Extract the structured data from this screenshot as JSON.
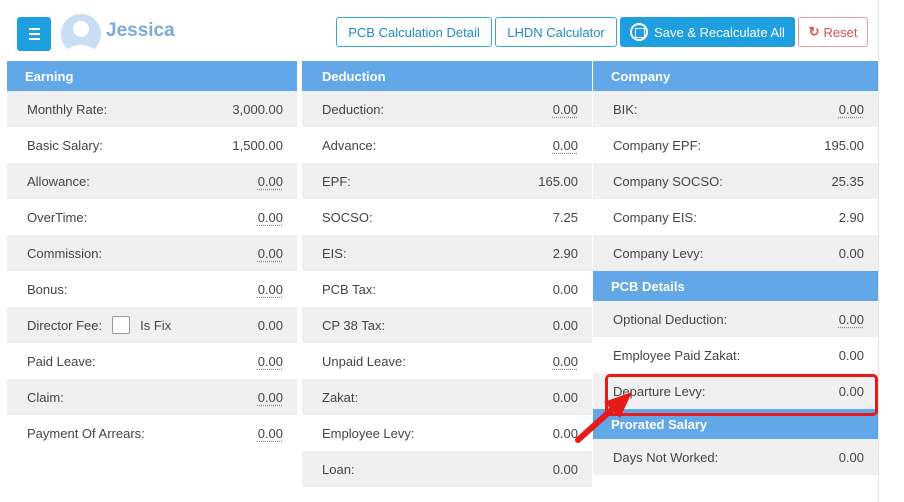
{
  "header": {
    "user_name": "Jessica",
    "buttons": {
      "pcb_detail": "PCB Calculation Detail",
      "lhdn": "LHDN Calculator",
      "save": "Save & Recalculate All",
      "reset": "Reset"
    }
  },
  "earning": {
    "title": "Earning",
    "rows": [
      {
        "label": "Monthly Rate:",
        "value": "3,000.00"
      },
      {
        "label": "Basic Salary:",
        "value": "1,500.00"
      },
      {
        "label": "Allowance:",
        "value": "0.00"
      },
      {
        "label": "OverTime:",
        "value": "0.00"
      },
      {
        "label": "Commission:",
        "value": "0.00"
      },
      {
        "label": "Bonus:",
        "value": "0.00"
      },
      {
        "label": "Director Fee:",
        "value": "0.00",
        "checkbox_label": "Is Fix"
      },
      {
        "label": "Paid Leave:",
        "value": "0.00"
      },
      {
        "label": "Claim:",
        "value": "0.00"
      },
      {
        "label": "Payment Of Arrears:",
        "value": "0.00"
      }
    ]
  },
  "deduction": {
    "title": "Deduction",
    "rows": [
      {
        "label": "Deduction:",
        "value": "0.00"
      },
      {
        "label": "Advance:",
        "value": "0.00"
      },
      {
        "label": "EPF:",
        "value": "165.00"
      },
      {
        "label": "SOCSO:",
        "value": "7.25"
      },
      {
        "label": "EIS:",
        "value": "2.90"
      },
      {
        "label": "PCB Tax:",
        "value": "0.00"
      },
      {
        "label": "CP 38 Tax:",
        "value": "0.00"
      },
      {
        "label": "Unpaid Leave:",
        "value": "0.00"
      },
      {
        "label": "Zakat:",
        "value": "0.00"
      },
      {
        "label": "Employee Levy:",
        "value": "0.00"
      },
      {
        "label": "Loan:",
        "value": "0.00"
      }
    ]
  },
  "company": {
    "title": "Company",
    "rows": [
      {
        "label": "BIK:",
        "value": "0.00"
      },
      {
        "label": "Company EPF:",
        "value": "195.00"
      },
      {
        "label": "Company SOCSO:",
        "value": "25.35"
      },
      {
        "label": "Company EIS:",
        "value": "2.90"
      },
      {
        "label": "Company Levy:",
        "value": "0.00"
      }
    ]
  },
  "pcb_details": {
    "title": "PCB Details",
    "rows": [
      {
        "label": "Optional Deduction:",
        "value": "0.00"
      },
      {
        "label": "Employee Paid Zakat:",
        "value": "0.00"
      },
      {
        "label": "Departure Levy:",
        "value": "0.00"
      }
    ]
  },
  "prorated_salary": {
    "title": "Prorated Salary",
    "rows": [
      {
        "label": "Days Not Worked:",
        "value": "0.00"
      }
    ]
  },
  "colors": {
    "primary": "#1e9fe0",
    "panel_header": "#62a7e8",
    "highlight": "#e81b1b"
  }
}
